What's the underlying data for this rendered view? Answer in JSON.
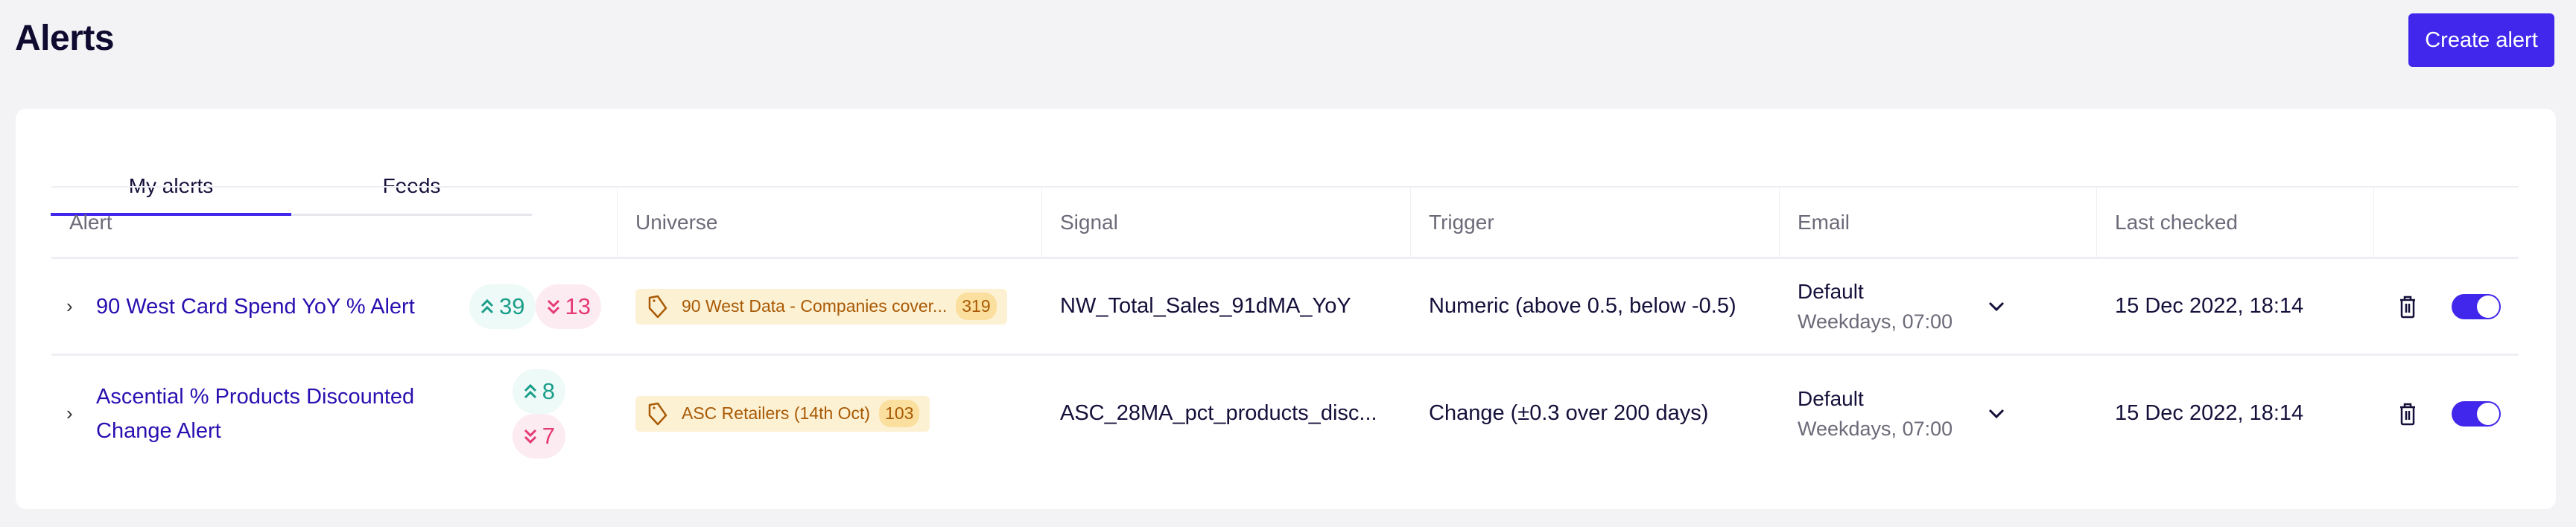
{
  "page": {
    "title": "Alerts",
    "create_button": "Create alert"
  },
  "tabs": [
    {
      "label": "My alerts",
      "active": true
    },
    {
      "label": "Feeds",
      "active": false
    }
  ],
  "columns": [
    "Alert",
    "Universe",
    "Signal",
    "Trigger",
    "Email",
    "Last checked",
    ""
  ],
  "rows": [
    {
      "name": "90 West Card Spend YoY % Alert",
      "up_count": "39",
      "down_count": "13",
      "universe": "90 West Data - Companies cover...",
      "universe_count": "319",
      "signal": "NW_Total_Sales_91dMA_YoY",
      "trigger": "Numeric (above 0.5, below -0.5)",
      "email_main": "Default",
      "email_sub": "Weekdays, 07:00",
      "last_checked": "15 Dec 2022, 18:14",
      "enabled": true
    },
    {
      "name": "Ascential % Products Discounted Change Alert",
      "up_count": "8",
      "down_count": "7",
      "universe": "ASC Retailers (14th Oct)",
      "universe_count": "103",
      "signal": "ASC_28MA_pct_products_disc...",
      "trigger": "Change (±0.3 over 200 days)",
      "email_main": "Default",
      "email_sub": "Weekdays, 07:00",
      "last_checked": "15 Dec 2022, 18:14",
      "enabled": true
    }
  ],
  "colors": {
    "accent": "#4127eb",
    "up": "#1a9e8a",
    "down": "#e53a76",
    "tag": "#a85a05"
  }
}
